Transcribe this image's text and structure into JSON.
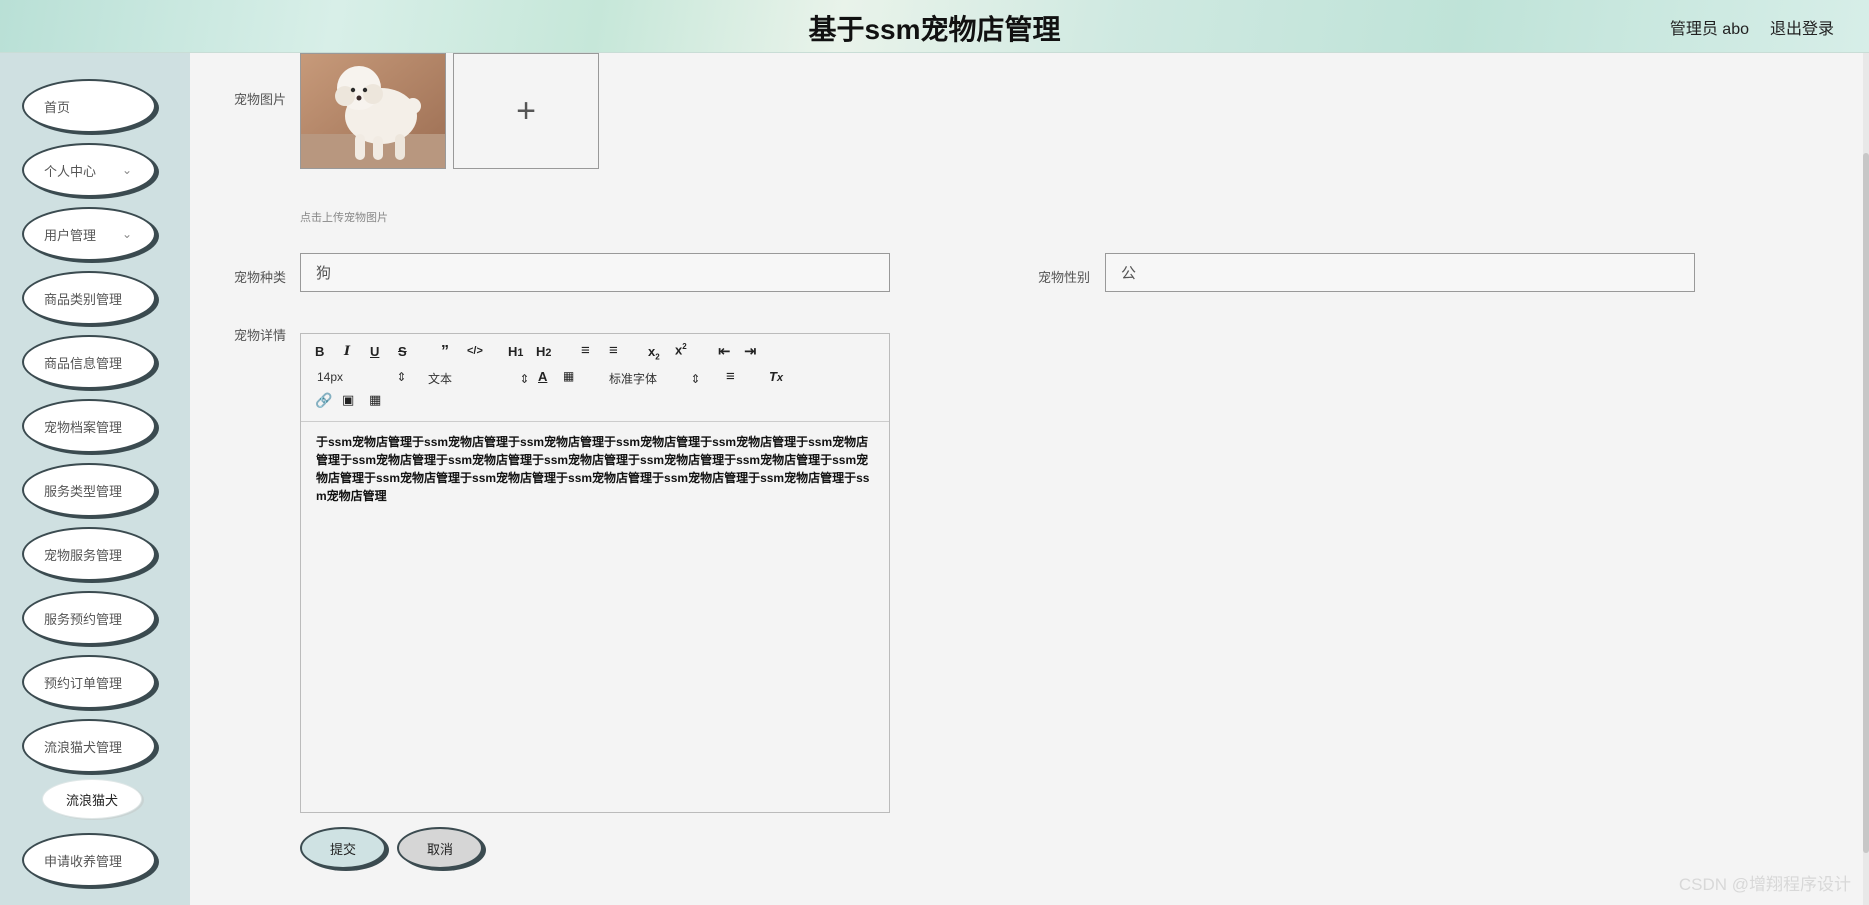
{
  "header": {
    "title": "基于ssm宠物店管理",
    "user": "管理员 abo",
    "logout": "退出登录"
  },
  "sidebar": {
    "items": [
      {
        "label": "首页",
        "chevron": false
      },
      {
        "label": "个人中心",
        "chevron": true
      },
      {
        "label": "用户管理",
        "chevron": true
      },
      {
        "label": "商品类别管理",
        "chevron": false
      },
      {
        "label": "商品信息管理",
        "chevron": false
      },
      {
        "label": "宠物档案管理",
        "chevron": false
      },
      {
        "label": "服务类型管理",
        "chevron": false
      },
      {
        "label": "宠物服务管理",
        "chevron": false
      },
      {
        "label": "服务预约管理",
        "chevron": false
      },
      {
        "label": "预约订单管理",
        "chevron": false
      },
      {
        "label": "流浪猫犬管理",
        "chevron": false
      },
      {
        "label": "申请收养管理",
        "chevron": false
      }
    ],
    "sub_item": "流浪猫犬"
  },
  "form": {
    "pet_image_label": "宠物图片",
    "upload_hint": "点击上传宠物图片",
    "species_label": "宠物种类",
    "species_value": "狗",
    "gender_label": "宠物性别",
    "gender_value": "公",
    "detail_label": "宠物详情",
    "submit": "提交",
    "cancel": "取消"
  },
  "editor": {
    "font_size": "14px",
    "header_select": "文本",
    "font_family": "标准字体",
    "content": "于ssm宠物店管理于ssm宠物店管理于ssm宠物店管理于ssm宠物店管理于ssm宠物店管理于ssm宠物店管理于ssm宠物店管理于ssm宠物店管理于ssm宠物店管理于ssm宠物店管理于ssm宠物店管理于ssm宠物店管理于ssm宠物店管理于ssm宠物店管理于ssm宠物店管理于ssm宠物店管理于ssm宠物店管理于ssm宠物店管理"
  },
  "watermark": "CSDN @增翔程序设计"
}
